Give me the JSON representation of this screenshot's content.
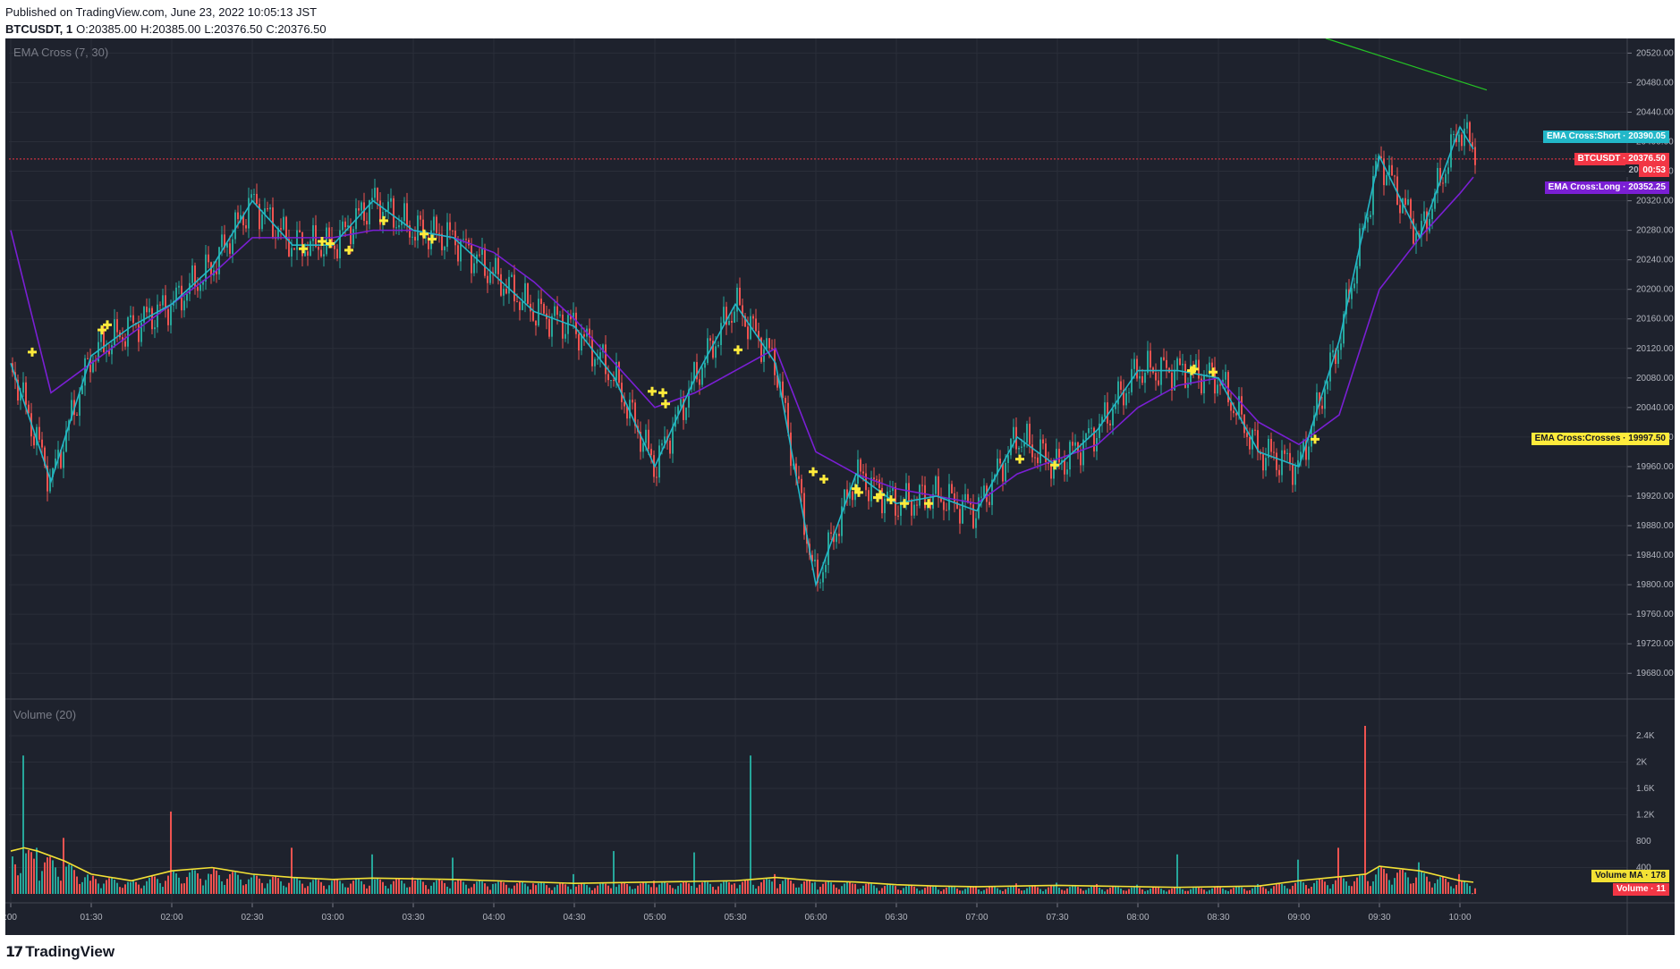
{
  "header": {
    "published": "Published on TradingView.com, June 23, 2022 10:05:13 JST",
    "symbol": "BTCUSDT, 1",
    "ohlc": [
      {
        "k": "O:",
        "v": "20385.00"
      },
      {
        "k": "H:",
        "v": "20385.00"
      },
      {
        "k": "L:",
        "v": "20376.50"
      },
      {
        "k": "C:",
        "v": "20376.50"
      }
    ]
  },
  "price_pane": {
    "title": "EMA Cross (7, 30)"
  },
  "volume_pane": {
    "title": "Volume (20)"
  },
  "footer": {
    "logo_glyph": "𝟭𝟳",
    "brand": "TradingView"
  },
  "labels": {
    "ema_short": "EMA Cross:Short · 20390.05",
    "btc": "BTCUSDT · 20376.50",
    "btc_partial": "20...",
    "countdown": "00:53",
    "ema_long": "EMA Cross:Long · 20352.25",
    "crosses": "EMA Cross:Crosses · 19997.50",
    "volume_ma": "Volume MA · 178",
    "volume": "Volume · 11"
  },
  "colors": {
    "background": "#1e222d",
    "up": "#26a69a",
    "down": "#ef5350",
    "ema_short": "#22b7c8",
    "ema_long": "#7a1fd4",
    "crosses": "#ffeb3b",
    "volume_ma": "#f3e135",
    "trendline": "#25c425",
    "price_line": "#f23645"
  },
  "chart_data": [
    {
      "type": "line",
      "title": "EMA Cross (7, 30)",
      "symbol": "BTCUSDT",
      "interval": "1",
      "x_ticks": [
        ":00",
        "01:30",
        "02:00",
        "02:30",
        "03:00",
        "03:30",
        "04:00",
        "04:30",
        "05:00",
        "05:30",
        "06:00",
        "06:30",
        "07:00",
        "07:30",
        "08:00",
        "08:30",
        "09:00",
        "09:30",
        "10:00"
      ],
      "y_ticks": [
        19680,
        19720,
        19760,
        19800,
        19840,
        19880,
        19920,
        19960,
        20000,
        20040,
        20080,
        20120,
        20160,
        20200,
        20240,
        20280,
        20320,
        20360,
        20400,
        20440,
        20480,
        20520
      ],
      "y_tick_labels": [
        "19680.00",
        "19720.00",
        "19760.00",
        "19800.00",
        "19840.00",
        "19880.00",
        "19920.00",
        "19960.00",
        "20000.00",
        "20040.00",
        "20080.00",
        "20120.00",
        "20160.00",
        "20200.00",
        "20240.00",
        "20280.00",
        "20320.00",
        "20360.00",
        "20400.00",
        "20440.00",
        "20480.00",
        "20520.00"
      ],
      "ylim": [
        19650,
        20535
      ],
      "x_time": [
        "01:00",
        "01:15",
        "01:30",
        "01:45",
        "02:00",
        "02:15",
        "02:30",
        "02:45",
        "03:00",
        "03:15",
        "03:30",
        "03:45",
        "04:00",
        "04:15",
        "04:30",
        "04:45",
        "05:00",
        "05:15",
        "05:30",
        "05:45",
        "06:00",
        "06:15",
        "06:30",
        "06:45",
        "07:00",
        "07:15",
        "07:30",
        "07:45",
        "08:00",
        "08:15",
        "08:30",
        "08:45",
        "09:00",
        "09:15",
        "09:30",
        "09:45",
        "10:00",
        "10:05"
      ],
      "series": [
        {
          "name": "EMA Cross:Short",
          "values": [
            20100,
            19940,
            20110,
            20150,
            20180,
            20230,
            20320,
            20260,
            20260,
            20320,
            20280,
            20270,
            20220,
            20170,
            20150,
            20080,
            19960,
            20080,
            20180,
            20100,
            19800,
            19950,
            19910,
            19920,
            19900,
            20000,
            19960,
            20010,
            20090,
            20090,
            20080,
            19980,
            19960,
            20130,
            20380,
            20270,
            20420,
            20390
          ]
        },
        {
          "name": "EMA Cross:Long",
          "values": [
            20280,
            20060,
            20100,
            20140,
            20180,
            20220,
            20270,
            20270,
            20270,
            20280,
            20280,
            20270,
            20250,
            20210,
            20160,
            20100,
            20040,
            20060,
            20090,
            20120,
            19980,
            19950,
            19930,
            19920,
            19910,
            19950,
            19970,
            19990,
            20040,
            20070,
            20080,
            20020,
            19990,
            20030,
            20200,
            20270,
            20330,
            20352
          ]
        },
        {
          "name": "EMA Cross:Crosses",
          "x": [
            "01:08",
            "01:34",
            "01:36",
            "02:49",
            "02:56",
            "02:59",
            "03:06",
            "03:19",
            "03:34",
            "03:37",
            "04:59",
            "05:03",
            "05:04",
            "05:31",
            "05:59",
            "06:03",
            "06:15",
            "06:16",
            "06:23",
            "06:24",
            "06:28",
            "06:33",
            "06:42",
            "07:16",
            "07:29",
            "08:20",
            "08:21",
            "08:28",
            "09:06"
          ],
          "values": [
            20115,
            20145,
            20152,
            20255,
            20265,
            20262,
            20253,
            20293,
            20275,
            20268,
            20062,
            20060,
            20045,
            20118,
            19953,
            19943,
            19930,
            19925,
            19918,
            19922,
            19915,
            19910,
            19910,
            19970,
            19962,
            20090,
            20092,
            20088,
            19997
          ]
        }
      ],
      "last_price": 20376.5,
      "trendline": {
        "from": {
          "time": "09:10",
          "price": 20540
        },
        "to": {
          "time": "10:10",
          "price": 20470
        }
      }
    },
    {
      "type": "bar",
      "title": "Volume (20)",
      "y_ticks": [
        400,
        800,
        1200,
        1600,
        2000,
        2400
      ],
      "y_tick_labels": [
        "400",
        "800",
        "1.2K",
        "1.6K",
        "2K",
        "2.4K"
      ],
      "ylim": [
        0,
        2550
      ],
      "x_time": [
        "01:00",
        "01:05",
        "01:10",
        "01:20",
        "01:30",
        "01:45",
        "02:00",
        "02:15",
        "02:30",
        "02:45",
        "03:00",
        "03:15",
        "03:30",
        "03:45",
        "04:00",
        "04:15",
        "04:30",
        "04:45",
        "05:00",
        "05:15",
        "05:30",
        "05:36",
        "05:45",
        "06:00",
        "06:15",
        "06:30",
        "06:45",
        "07:00",
        "07:15",
        "07:30",
        "07:45",
        "08:00",
        "08:15",
        "08:30",
        "08:45",
        "09:00",
        "09:15",
        "09:25",
        "09:30",
        "09:45",
        "10:00",
        "10:05"
      ],
      "values": [
        600,
        2100,
        700,
        850,
        200,
        180,
        1250,
        300,
        250,
        700,
        200,
        600,
        250,
        550,
        150,
        160,
        300,
        650,
        200,
        630,
        160,
        2100,
        300,
        180,
        150,
        120,
        130,
        120,
        160,
        170,
        150,
        140,
        600,
        120,
        150,
        520,
        700,
        2550,
        400,
        480,
        300,
        11
      ],
      "series": [
        {
          "name": "Volume MA",
          "values": [
            650,
            700,
            650,
            500,
            300,
            200,
            350,
            400,
            300,
            250,
            220,
            240,
            230,
            220,
            200,
            180,
            160,
            170,
            180,
            190,
            200,
            220,
            250,
            200,
            180,
            140,
            120,
            110,
            120,
            130,
            120,
            110,
            100,
            110,
            120,
            200,
            260,
            300,
            420,
            350,
            200,
            178
          ]
        }
      ]
    }
  ]
}
